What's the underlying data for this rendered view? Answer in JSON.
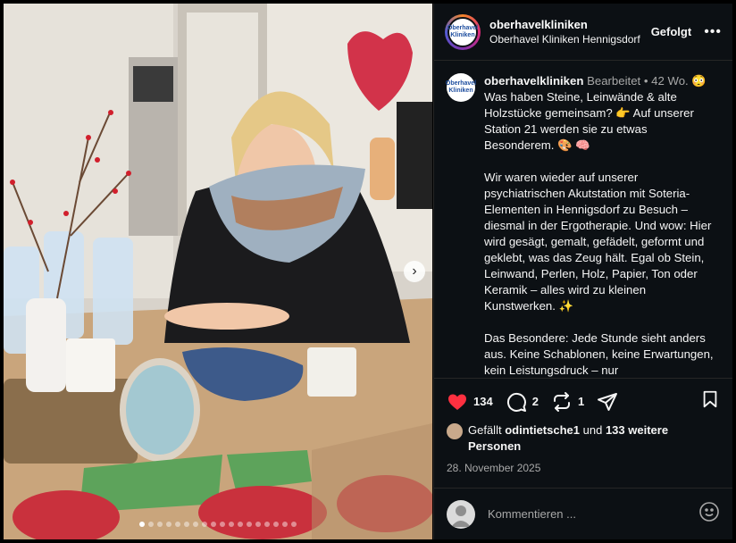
{
  "header": {
    "username": "oberhavelkliniken",
    "subtitle": "Oberhavel Kliniken Hennigsdorf",
    "follow_label": "Gefolgt",
    "more": "•••",
    "avatar_text": "Oberhavel Kliniken"
  },
  "caption": {
    "username": "oberhavelkliniken",
    "edited": "Bearbeitet",
    "age": "• 42 Wo.",
    "para1": "😳 Was haben Steine, Leinwände & alte Holzstücke gemeinsam? 👉 Auf unserer Station 21 werden sie zu etwas Besonderem. 🎨 🧠",
    "para2": "Wir waren wieder auf unserer psychiatrischen Akutstation mit Soteria-Elementen in Hennigsdorf zu Besuch – diesmal in der Ergotherapie. Und wow: Hier wird gesägt, gemalt, gefädelt, geformt und geklebt, was das Zeug hält. Egal ob Stein, Leinwand, Perlen, Holz, Papier, Ton oder Keramik – alles wird zu kleinen Kunstwerken. ✨",
    "para3": "Das Besondere: Jede Stunde sieht anders aus. Keine Schablonen, keine Erwartungen, kein Leistungsdruck – nur"
  },
  "actions": {
    "like_count": "134",
    "comment_count": "2",
    "share_count": "1"
  },
  "likes": {
    "prefix": "Gefällt",
    "user": "odintietsche1",
    "middle": "und",
    "others": "133 weitere Personen"
  },
  "date": "28. November 2025",
  "comment": {
    "placeholder": "Kommentieren ..."
  },
  "carousel": {
    "total": 18,
    "current": 1
  },
  "colors": {
    "heart": "#ff3040",
    "panel_bg": "#0c1014"
  }
}
